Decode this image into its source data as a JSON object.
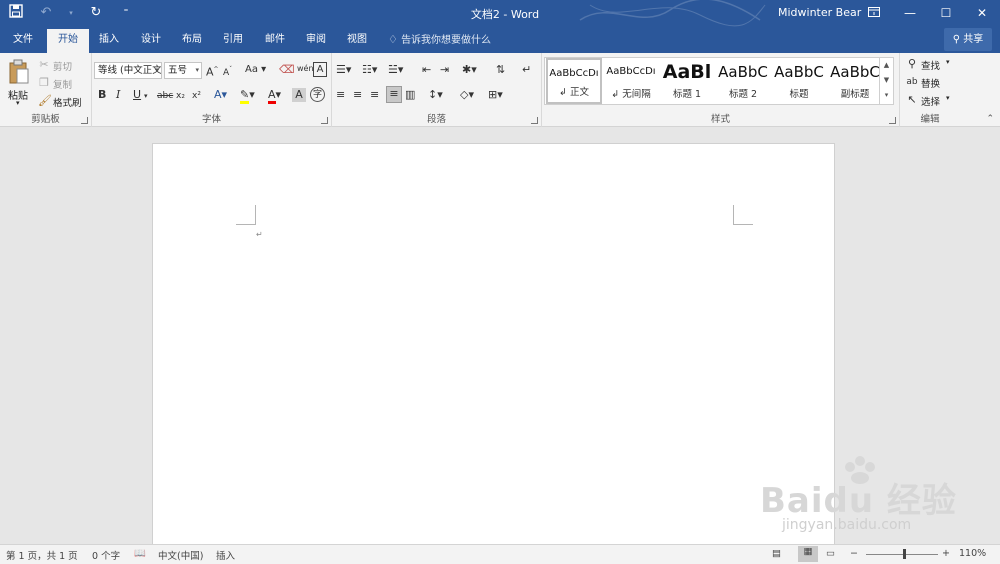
{
  "title_bar": {
    "doc_title": "文档2 - Word",
    "user": "Midwinter Bear",
    "qat_icons": [
      "save-icon",
      "undo-icon",
      "redo-icon",
      "customize-icon"
    ],
    "window_buttons": [
      "ribbon-display-icon",
      "minimize-icon",
      "maximize-icon",
      "close-icon"
    ]
  },
  "tabs": [
    {
      "label": "文件"
    },
    {
      "label": "开始",
      "active": true
    },
    {
      "label": "插入"
    },
    {
      "label": "设计"
    },
    {
      "label": "布局"
    },
    {
      "label": "引用"
    },
    {
      "label": "邮件"
    },
    {
      "label": "审阅"
    },
    {
      "label": "视图"
    }
  ],
  "tell_me": "告诉我你想要做什么",
  "share": "共享",
  "ribbon": {
    "clipboard": {
      "label": "剪贴板",
      "paste": "粘贴",
      "cut": "剪切",
      "copy": "复制",
      "format_painter": "格式刷"
    },
    "font": {
      "label": "字体",
      "font_name": "等线 (中文正文",
      "font_size": "五号",
      "bold": "B",
      "italic": "I",
      "underline": "U",
      "strike": "abc",
      "subscript": "x₂",
      "superscript": "x²",
      "change_case": "Aa",
      "grow": "A",
      "shrink": "A"
    },
    "paragraph": {
      "label": "段落"
    },
    "styles": {
      "label": "样式",
      "items": [
        {
          "preview": "AaBbCcDı",
          "name": "正文"
        },
        {
          "preview": "AaBbCcDı",
          "name": "无间隔"
        },
        {
          "preview": "AaBl",
          "name": "标题 1"
        },
        {
          "preview": "AaBbC",
          "name": "标题 2"
        },
        {
          "preview": "AaBbC",
          "name": "标题"
        },
        {
          "preview": "AaBbC",
          "name": "副标题"
        }
      ]
    },
    "editing": {
      "label": "编辑",
      "find": "查找",
      "replace": "替换",
      "select": "选择"
    }
  },
  "status_bar": {
    "page": "第 1 页，共 1 页",
    "words": "0 个字",
    "language": "中文(中国)",
    "mode": "插入",
    "zoom": "110%"
  },
  "watermark": {
    "main": "Baidu 经验",
    "sub": "jingyan.baidu.com"
  }
}
